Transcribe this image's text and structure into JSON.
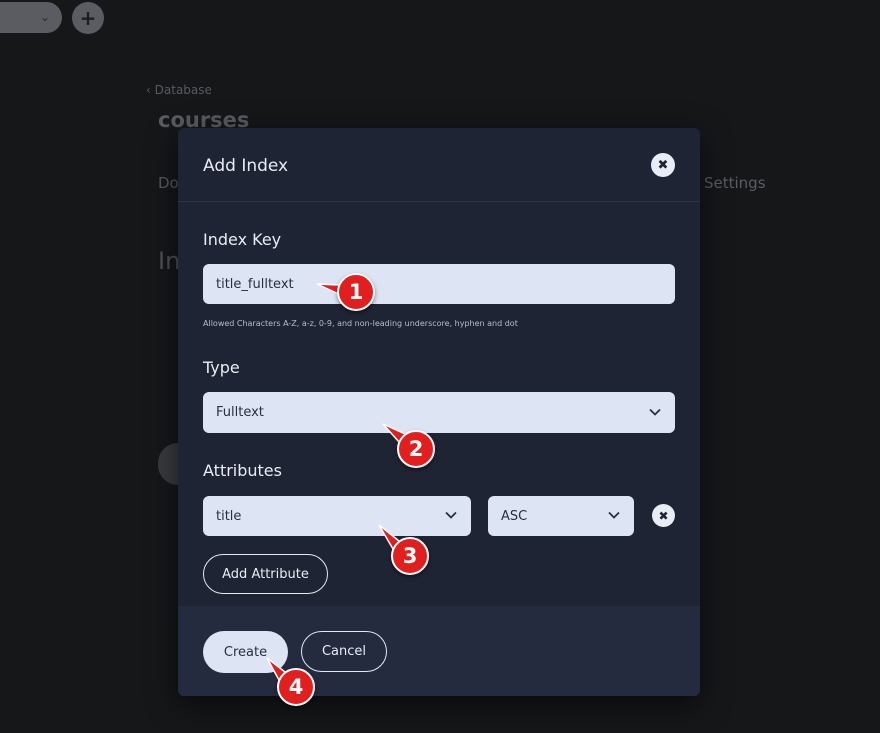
{
  "background": {
    "breadcrumb": "Database",
    "page_title": "courses",
    "tab_partial": "Do",
    "tab_settings": "Settings",
    "section_partial": "In"
  },
  "modal": {
    "title": "Add Index",
    "index_key": {
      "label": "Index Key",
      "value": "title_fulltext",
      "hint": "Allowed Characters A-Z, a-z, 0-9, and non-leading underscore, hyphen and dot"
    },
    "type": {
      "label": "Type",
      "selected": "Fulltext"
    },
    "attributes": {
      "label": "Attributes",
      "rows": [
        {
          "attribute": "title",
          "order": "ASC"
        }
      ],
      "add_label": "Add Attribute"
    },
    "footer": {
      "create_label": "Create",
      "cancel_label": "Cancel"
    }
  },
  "annotations": [
    {
      "number": "1",
      "target": "index-key-input"
    },
    {
      "number": "2",
      "target": "type-select"
    },
    {
      "number": "3",
      "target": "attribute-select"
    },
    {
      "number": "4",
      "target": "create-button"
    }
  ],
  "colors": {
    "modal_bg": "#1f2434",
    "footer_bg": "#252b3e",
    "field_bg": "#dde5f4",
    "marker": "#e21f1f",
    "page_bg": "#161719"
  }
}
